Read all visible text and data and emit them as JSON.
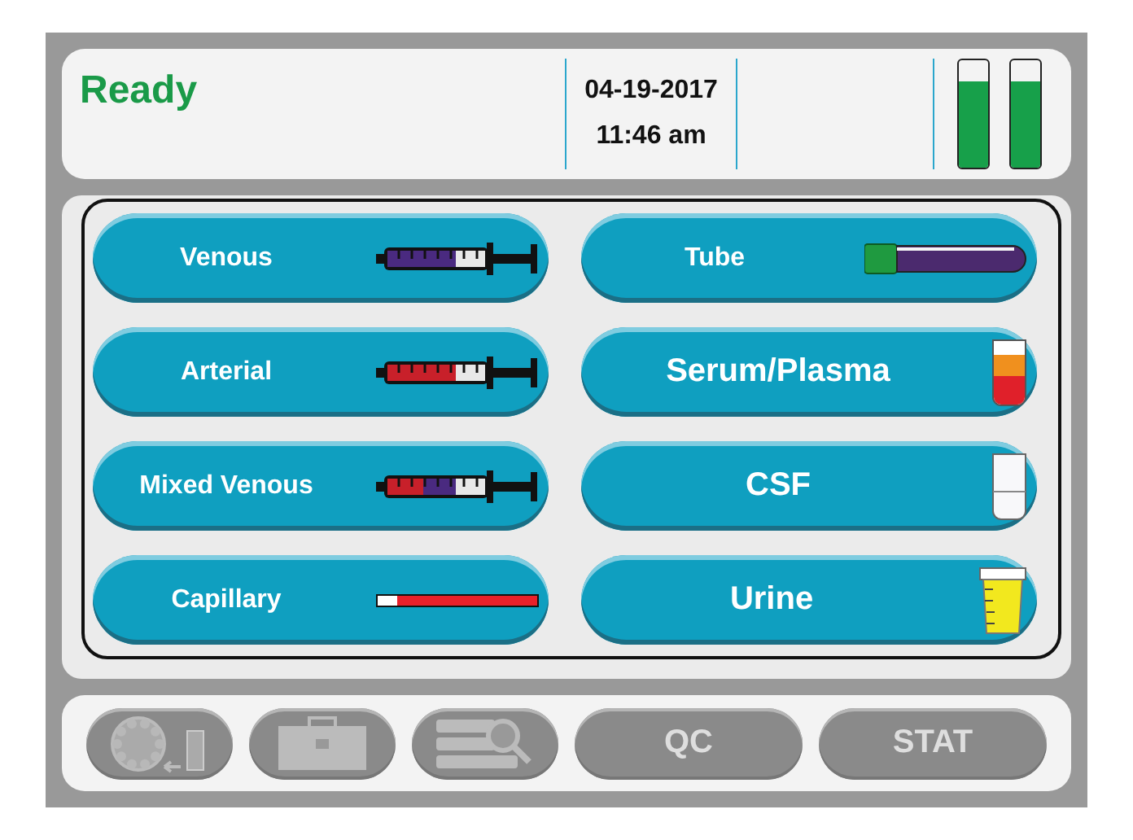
{
  "status": {
    "text": "Ready",
    "date": "04-19-2017",
    "time": "11:46 am"
  },
  "levels": [
    {
      "level": 0.8
    },
    {
      "level": 0.8
    }
  ],
  "sample_types": [
    {
      "label": "Venous",
      "kind": "syringe-venous"
    },
    {
      "label": "Tube",
      "kind": "tube"
    },
    {
      "label": "Arterial",
      "kind": "syringe-arterial"
    },
    {
      "label": "Serum/Plasma",
      "kind": "serum"
    },
    {
      "label": "Mixed Venous",
      "kind": "syringe-mixed"
    },
    {
      "label": "CSF",
      "kind": "csf"
    },
    {
      "label": "Capillary",
      "kind": "capillary"
    },
    {
      "label": "Urine",
      "kind": "urine"
    }
  ],
  "toolbar": [
    {
      "kind": "carousel",
      "disabled": true
    },
    {
      "kind": "toolbox",
      "disabled": true
    },
    {
      "kind": "search-list",
      "disabled": true
    },
    {
      "kind": "text",
      "label": "QC",
      "disabled": true
    },
    {
      "kind": "text",
      "label": "STAT",
      "disabled": true
    }
  ]
}
